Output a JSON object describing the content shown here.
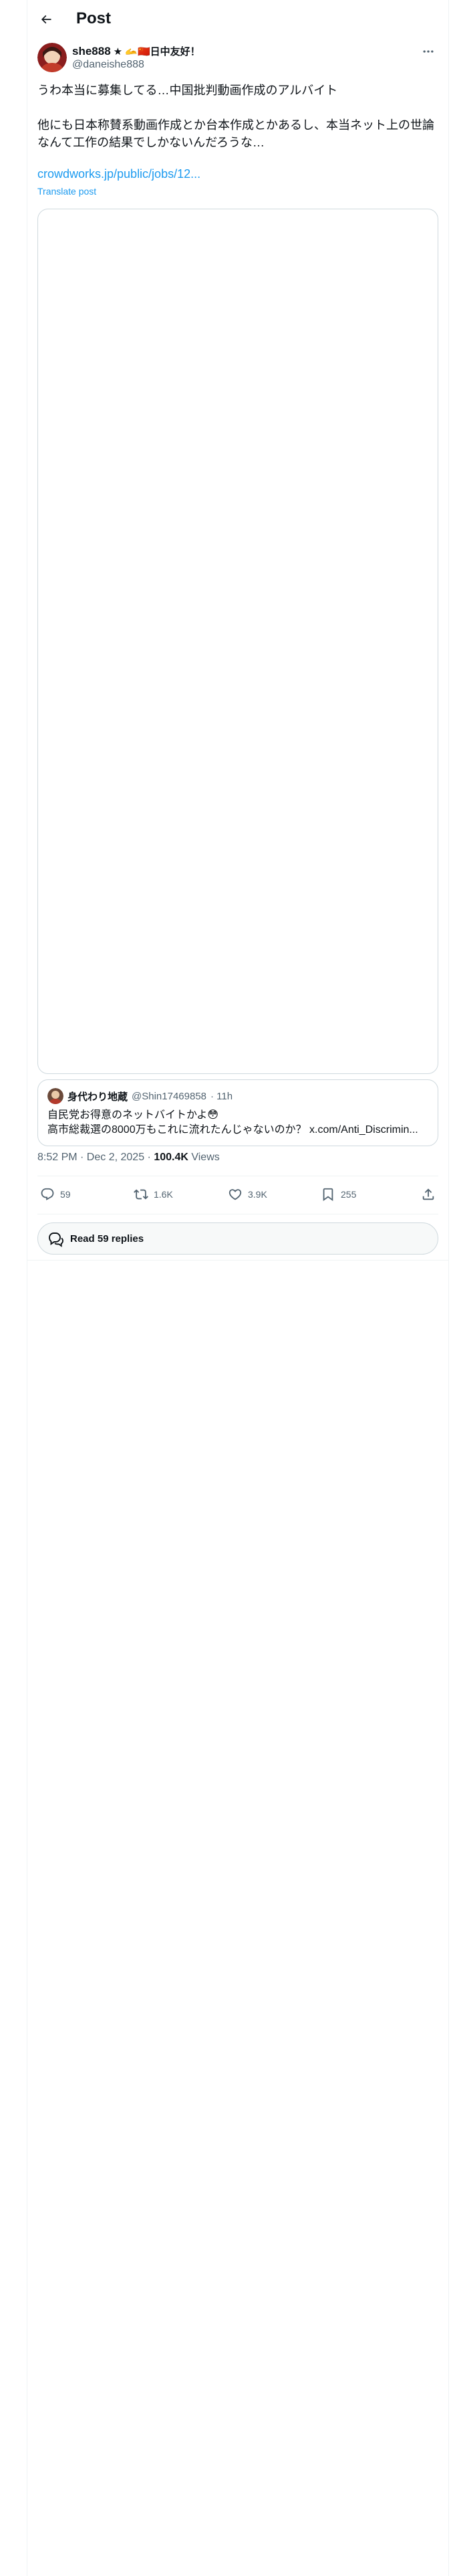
{
  "header": {
    "title": "Post"
  },
  "author": {
    "name": "she888",
    "badges": "★ 🫴🇨🇳日中友好！",
    "handle": "@daneishe888"
  },
  "tweet": {
    "text": "うわ本当に募集してる…中国批判動画作成のアルバイト\n\n他にも日本称賛系動画作成とか台本作成とかあるし、本当ネット上の世論なんて工作の結果でしかないんだろうな…",
    "link": "crowdworks.jp/public/jobs/12...",
    "translate_label": "Translate post"
  },
  "quote": {
    "name": "身代わり地蔵",
    "handle": "@Shin17469858",
    "time": "· 11h",
    "line1": "自民党お得意のネットバイトかよ😳",
    "line2": "高市総裁選の8000万もこれに流れたんじゃないのか？ x.com/Anti_Discrimin..."
  },
  "meta": {
    "time": "8:52 PM · Dec 2, 2025 · ",
    "views_count": "100.4K",
    "views_label": " Views"
  },
  "actions": {
    "replies": "59",
    "reposts": "1.6K",
    "likes": "3.9K",
    "bookmarks": "255"
  },
  "read_replies": {
    "label": "Read 59 replies"
  },
  "colors": {
    "accent": "#1d9bf0",
    "text": "#0f1419",
    "muted": "#536471",
    "border": "#cfd9de"
  },
  "icons": [
    "back-arrow-icon",
    "more-icon",
    "reply-icon",
    "repost-icon",
    "like-icon",
    "bookmark-icon",
    "share-icon",
    "chat-bubbles-icon"
  ]
}
